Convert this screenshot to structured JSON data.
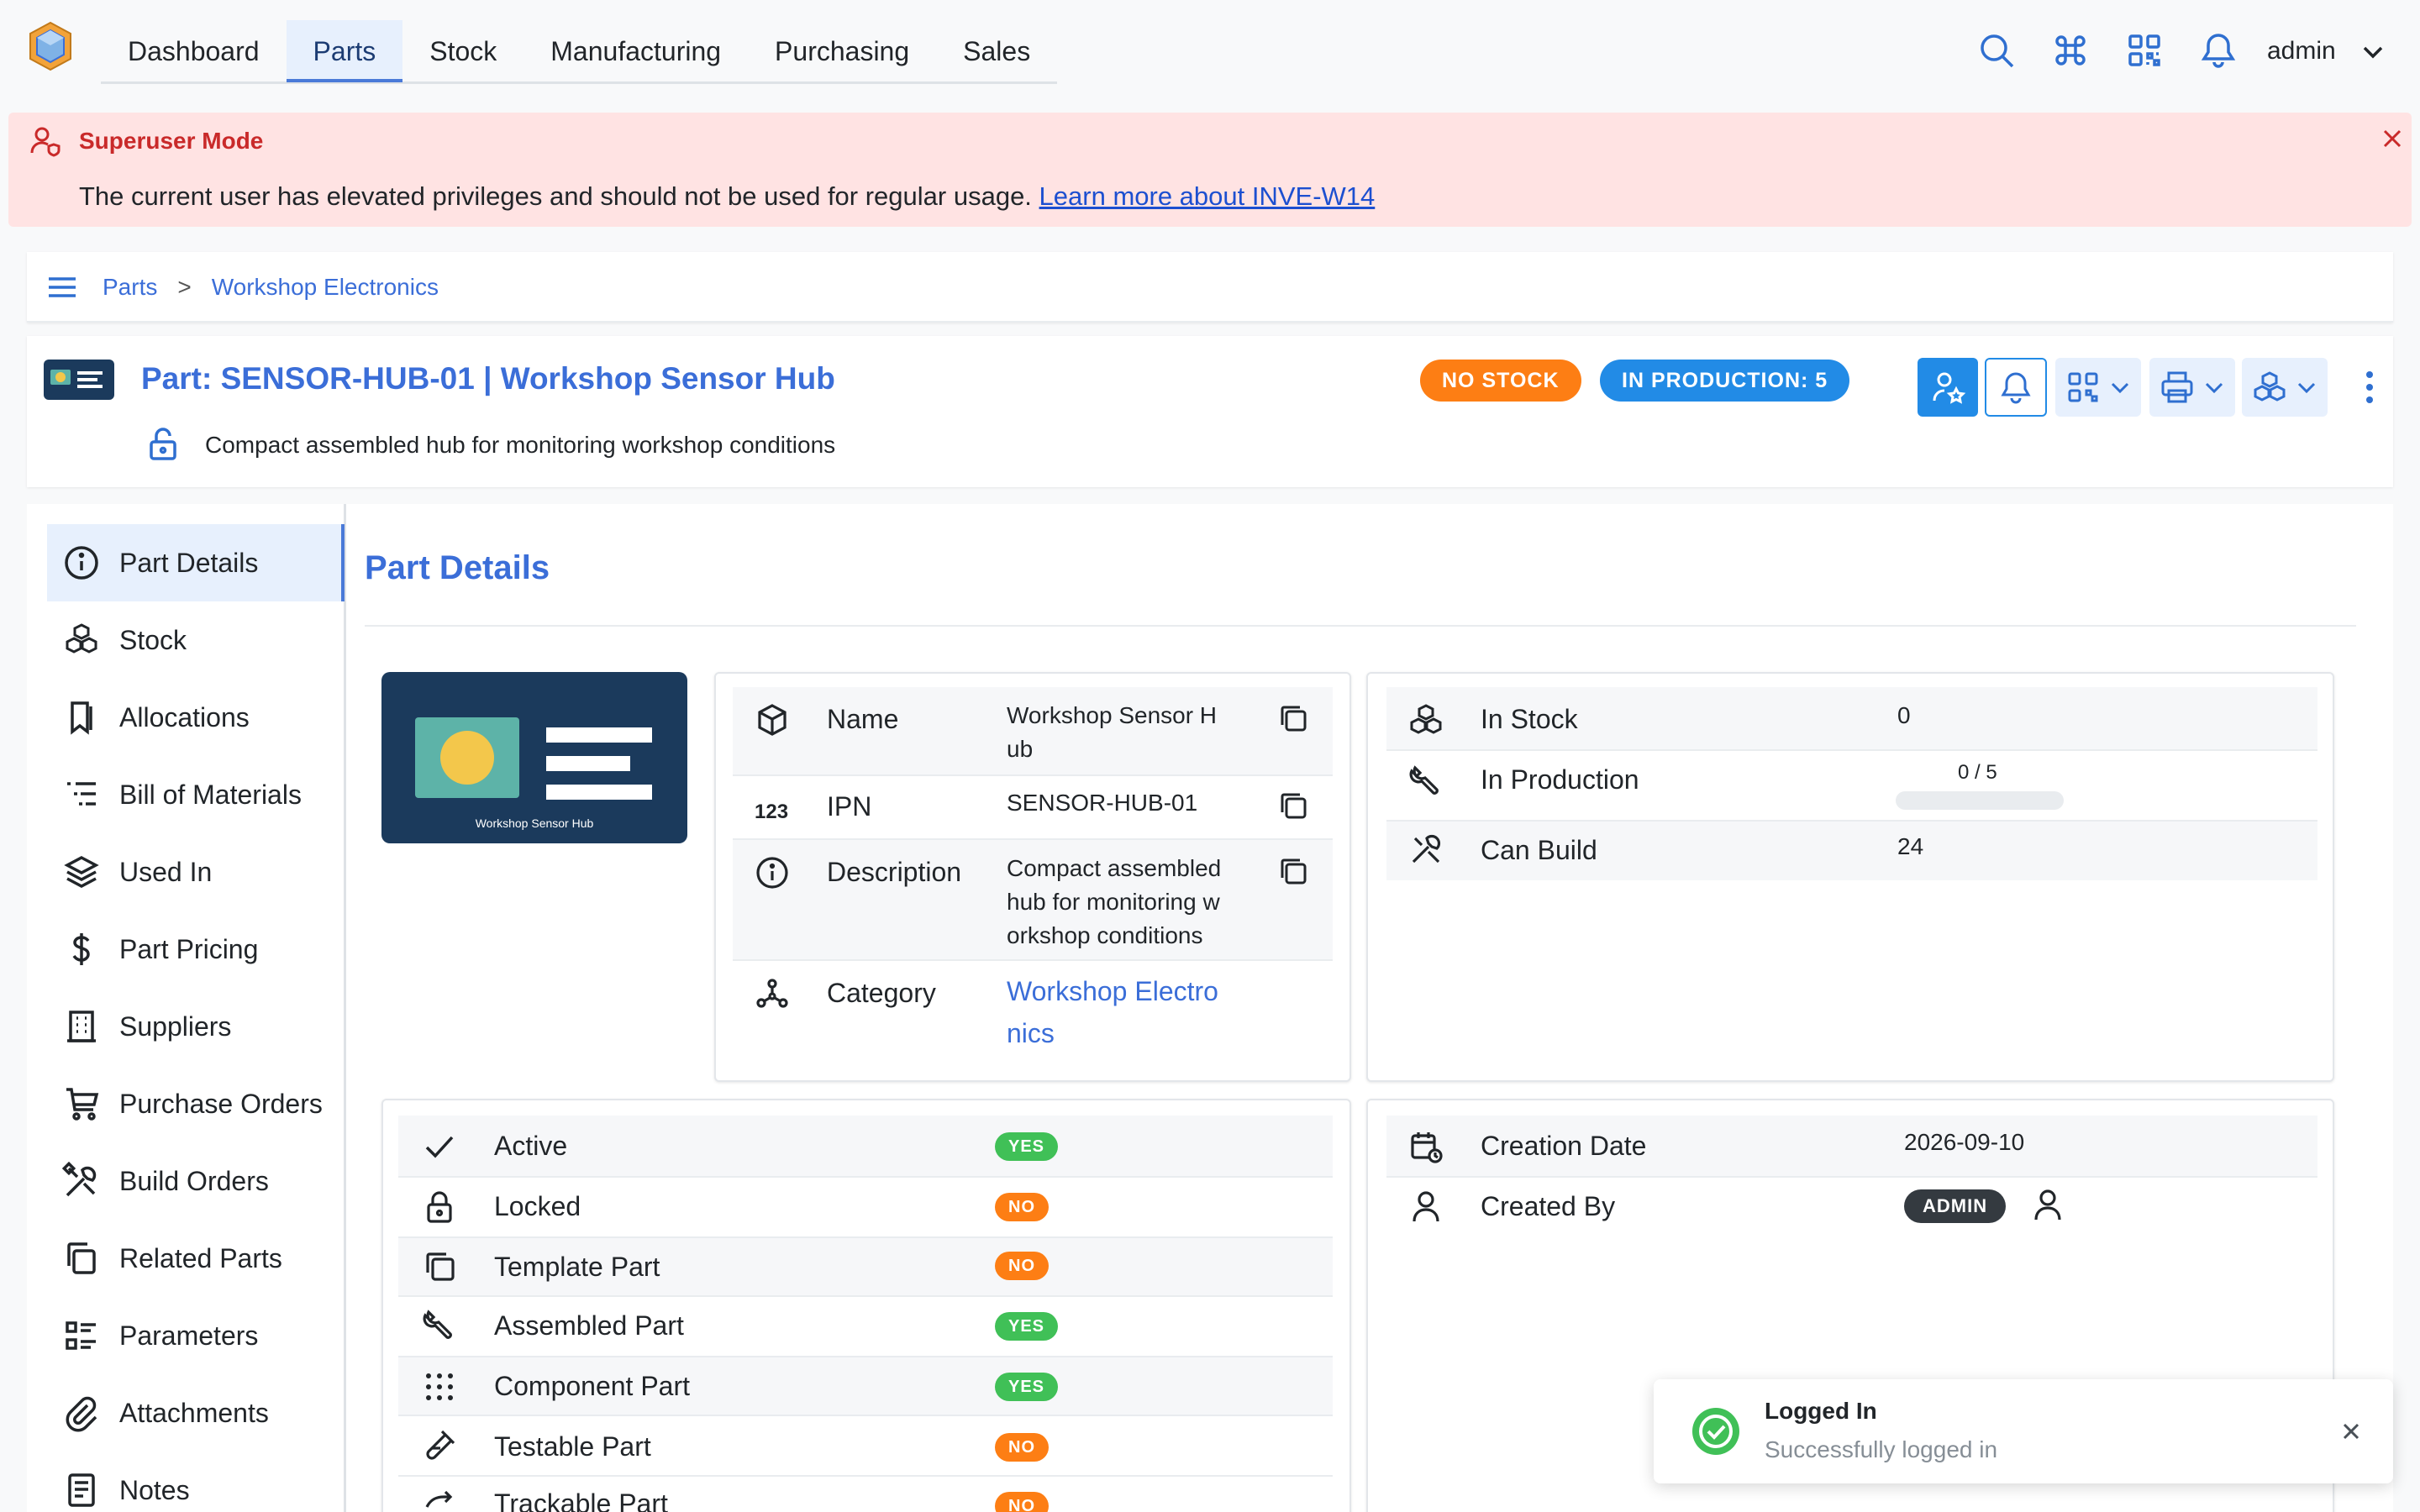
{
  "header": {
    "nav": [
      "Dashboard",
      "Parts",
      "Stock",
      "Manufacturing",
      "Purchasing",
      "Sales"
    ],
    "active_tab": "Parts",
    "icons": [
      "search-icon",
      "command-icon",
      "qr-code-icon",
      "bell-icon"
    ],
    "user": "admin"
  },
  "alert": {
    "title": "Superuser Mode",
    "message": "The current user has elevated privileges and should not be used for regular usage.",
    "link": "Learn more about INVE-W14"
  },
  "breadcrumb": [
    "Parts",
    "Workshop Electronics"
  ],
  "part": {
    "title": "Part: SENSOR-HUB-01 | Workshop Sensor Hub",
    "description": "Compact assembled hub for monitoring workshop conditions",
    "badge_stock": "NO STOCK",
    "badge_production": "IN PRODUCTION: 5"
  },
  "sidebar": [
    {
      "label": "Part Details",
      "icon": "info-icon"
    },
    {
      "label": "Stock",
      "icon": "boxes-icon"
    },
    {
      "label": "Allocations",
      "icon": "bookmark-icon"
    },
    {
      "label": "Bill of Materials",
      "icon": "list-tree-icon"
    },
    {
      "label": "Used In",
      "icon": "stack-icon"
    },
    {
      "label": "Part Pricing",
      "icon": "dollar-icon"
    },
    {
      "label": "Suppliers",
      "icon": "building-icon"
    },
    {
      "label": "Purchase Orders",
      "icon": "cart-icon"
    },
    {
      "label": "Build Orders",
      "icon": "tools-icon"
    },
    {
      "label": "Related Parts",
      "icon": "copy-icon"
    },
    {
      "label": "Parameters",
      "icon": "parameters-icon"
    },
    {
      "label": "Attachments",
      "icon": "paperclip-icon"
    },
    {
      "label": "Notes",
      "icon": "notes-icon"
    }
  ],
  "main": {
    "title": "Part Details",
    "image_caption": "Workshop Sensor Hub",
    "details": {
      "name_label": "Name",
      "name_value": [
        "Workshop Sensor H",
        "ub"
      ],
      "ipn_label": "IPN",
      "ipn_value": "SENSOR-HUB-01",
      "desc_label": "Description",
      "desc_value": [
        "Compact assembled",
        "hub for monitoring w",
        "orkshop conditions"
      ],
      "category_label": "Category",
      "category_value": [
        "Workshop Electro",
        "nics"
      ]
    },
    "stock": {
      "in_stock_label": "In Stock",
      "in_stock_value": "0",
      "in_production_label": "In Production",
      "in_production_value": "0 / 5",
      "in_production_fraction": 0,
      "can_build_label": "Can Build",
      "can_build_value": "24"
    },
    "flags": [
      {
        "label": "Active",
        "value": "YES",
        "icon": "check-icon"
      },
      {
        "label": "Locked",
        "value": "NO",
        "icon": "lock-icon"
      },
      {
        "label": "Template Part",
        "value": "NO",
        "icon": "copy-icon"
      },
      {
        "label": "Assembled Part",
        "value": "YES",
        "icon": "wrench-icon"
      },
      {
        "label": "Component Part",
        "value": "YES",
        "icon": "grid-dots-icon"
      },
      {
        "label": "Testable Part",
        "value": "NO",
        "icon": "test-icon"
      },
      {
        "label": "Trackable Part",
        "value": "NO",
        "icon": "route-icon"
      }
    ],
    "meta": {
      "creation_label": "Creation Date",
      "creation_value": "2026-09-10",
      "created_by_label": "Created By",
      "created_by_value": "ADMIN"
    }
  },
  "toast": {
    "title": "Logged In",
    "message": "Successfully logged in"
  },
  "colors": {
    "accent": "#3b6ed8",
    "no_stock": "#fd7e14",
    "production": "#228be6",
    "yes": "#40c057",
    "no": "#fd7e14",
    "alert_bg": "#ffe3e3"
  }
}
